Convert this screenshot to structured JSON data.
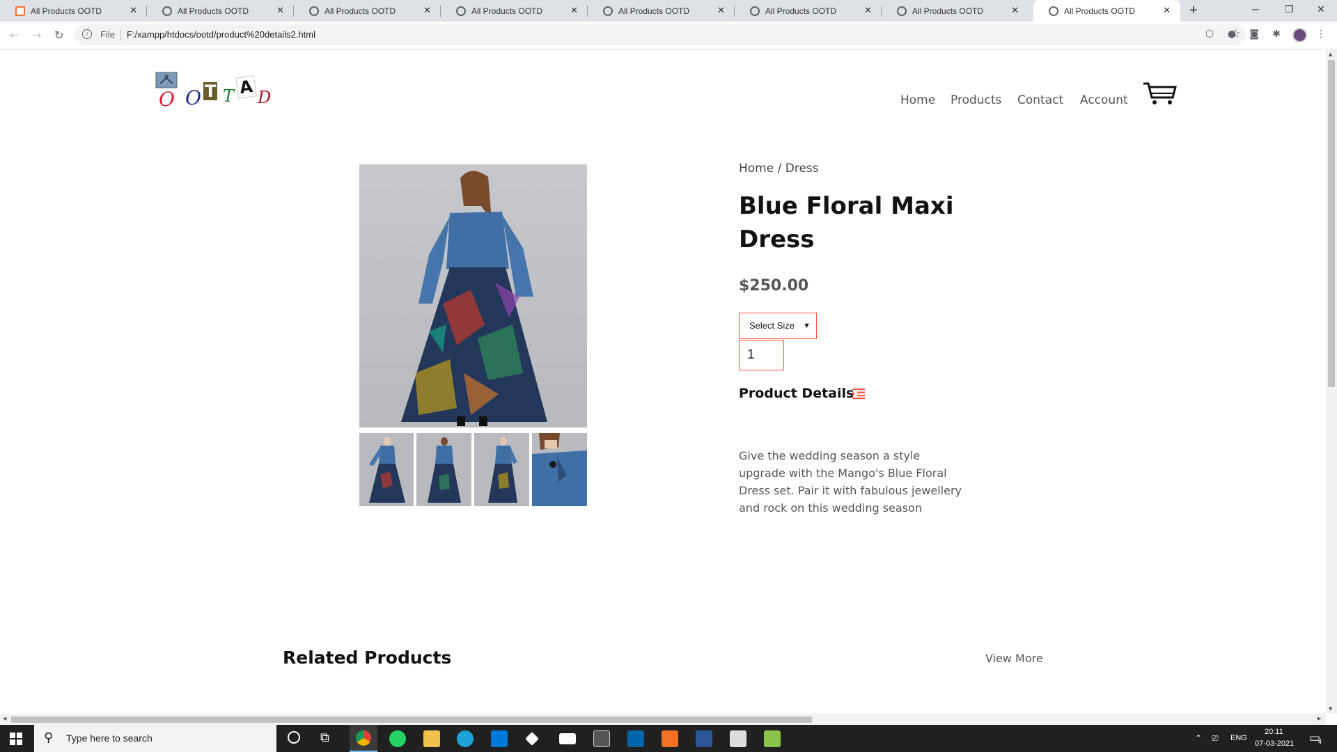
{
  "browser": {
    "tabs": [
      {
        "title": "All Products OOTD"
      },
      {
        "title": "All Products OOTD"
      },
      {
        "title": "All Products OOTD"
      },
      {
        "title": "All Products OOTD"
      },
      {
        "title": "All Products OOTD"
      },
      {
        "title": "All Products OOTD"
      },
      {
        "title": "All Products OOTD"
      },
      {
        "title": "All Products OOTD"
      }
    ],
    "new_tab": "+",
    "scheme_label": "File",
    "url": "F:/xampp/htdocs/ootd/product%20details2.html"
  },
  "site": {
    "logo_letters": [
      "O",
      "O",
      "T",
      "T",
      "A",
      "D"
    ],
    "nav": [
      "Home",
      "Products",
      "Contact",
      "Account"
    ]
  },
  "product": {
    "breadcrumb": "Home / Dress",
    "title": "Blue Floral Maxi Dress",
    "price": "$250.00",
    "size_select": "Select Size",
    "quantity": "1",
    "details_heading": "Product Details",
    "description": "Give the wedding season a style upgrade with the Mango's Blue Floral Dress set. Pair it with fabulous jewellery and rock on this wedding season"
  },
  "related": {
    "heading": "Related Products",
    "view_more": "View More"
  },
  "taskbar": {
    "search_placeholder": "Type here to search",
    "language": "ENG",
    "time": "20:11",
    "date": "07-03-2021",
    "notification_count": "4"
  },
  "colors": {
    "accent": "#ff523b",
    "taskbar": "#202020",
    "tabbar": "#dee1e6"
  }
}
